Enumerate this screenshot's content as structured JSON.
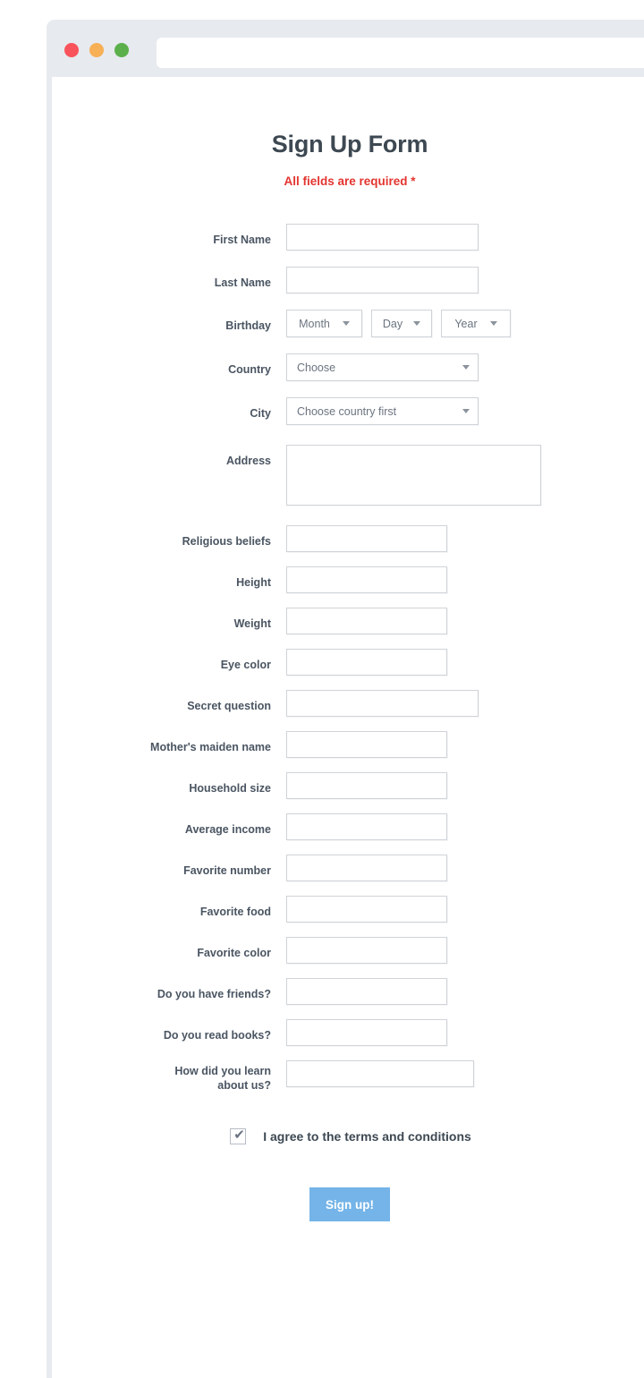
{
  "browser": {
    "traffic_lights": [
      {
        "name": "close",
        "color": "#f9545b"
      },
      {
        "name": "minimize",
        "color": "#f7b055"
      },
      {
        "name": "maximize",
        "color": "#5cb04c"
      }
    ],
    "url_bar_value": "",
    "url_bar_placeholder": ""
  },
  "form": {
    "title": "Sign Up Form",
    "subtitle": "All fields are required *",
    "fields": {
      "first_name": {
        "label": "First Name",
        "value": "",
        "placeholder": ""
      },
      "last_name": {
        "label": "Last Name",
        "value": "",
        "placeholder": ""
      },
      "birthday": {
        "label": "Birthday",
        "month": "Month",
        "day": "Day",
        "year": "Year"
      },
      "country": {
        "label": "Country",
        "value": "Choose"
      },
      "city": {
        "label": "City",
        "value": "Choose country first"
      },
      "address": {
        "label": "Address",
        "value": "",
        "placeholder": ""
      },
      "religious_beliefs": {
        "label": "Religious beliefs",
        "value": "",
        "placeholder": ""
      },
      "height": {
        "label": "Height",
        "value": "",
        "placeholder": ""
      },
      "weight": {
        "label": "Weight",
        "value": "",
        "placeholder": ""
      },
      "eye_color": {
        "label": "Eye color",
        "value": "",
        "placeholder": ""
      },
      "secret_question": {
        "label": "Secret question",
        "value": "",
        "placeholder": ""
      },
      "mothers_maiden_name": {
        "label": "Mother's maiden name",
        "value": "",
        "placeholder": ""
      },
      "household_size": {
        "label": "Household size",
        "value": "",
        "placeholder": ""
      },
      "average_income": {
        "label": "Average income",
        "value": "",
        "placeholder": ""
      },
      "favorite_number": {
        "label": "Favorite number",
        "value": "",
        "placeholder": ""
      },
      "favorite_food": {
        "label": "Favorite food",
        "value": "",
        "placeholder": ""
      },
      "favorite_color": {
        "label": "Favorite color",
        "value": "",
        "placeholder": ""
      },
      "have_friends": {
        "label": "Do you have friends?",
        "value": "",
        "placeholder": ""
      },
      "read_books": {
        "label": "Do you read books?",
        "value": "",
        "placeholder": ""
      },
      "learn_about_us": {
        "label_line1": "How did you learn",
        "label_line2": "about us?",
        "value": "",
        "placeholder": ""
      }
    },
    "agreement": {
      "label": "I agree to the terms and conditions",
      "checked": true,
      "check_glyph": "✔"
    },
    "submit_label": "Sign up!"
  },
  "colors": {
    "title": "#3d4852",
    "required_text": "#e3342f",
    "label": "#4a5562",
    "field_border": "#cfd3d8",
    "placeholder": "#6b7480",
    "submit_bg": "#74b4e8",
    "chrome_bg": "#e7eaee"
  }
}
